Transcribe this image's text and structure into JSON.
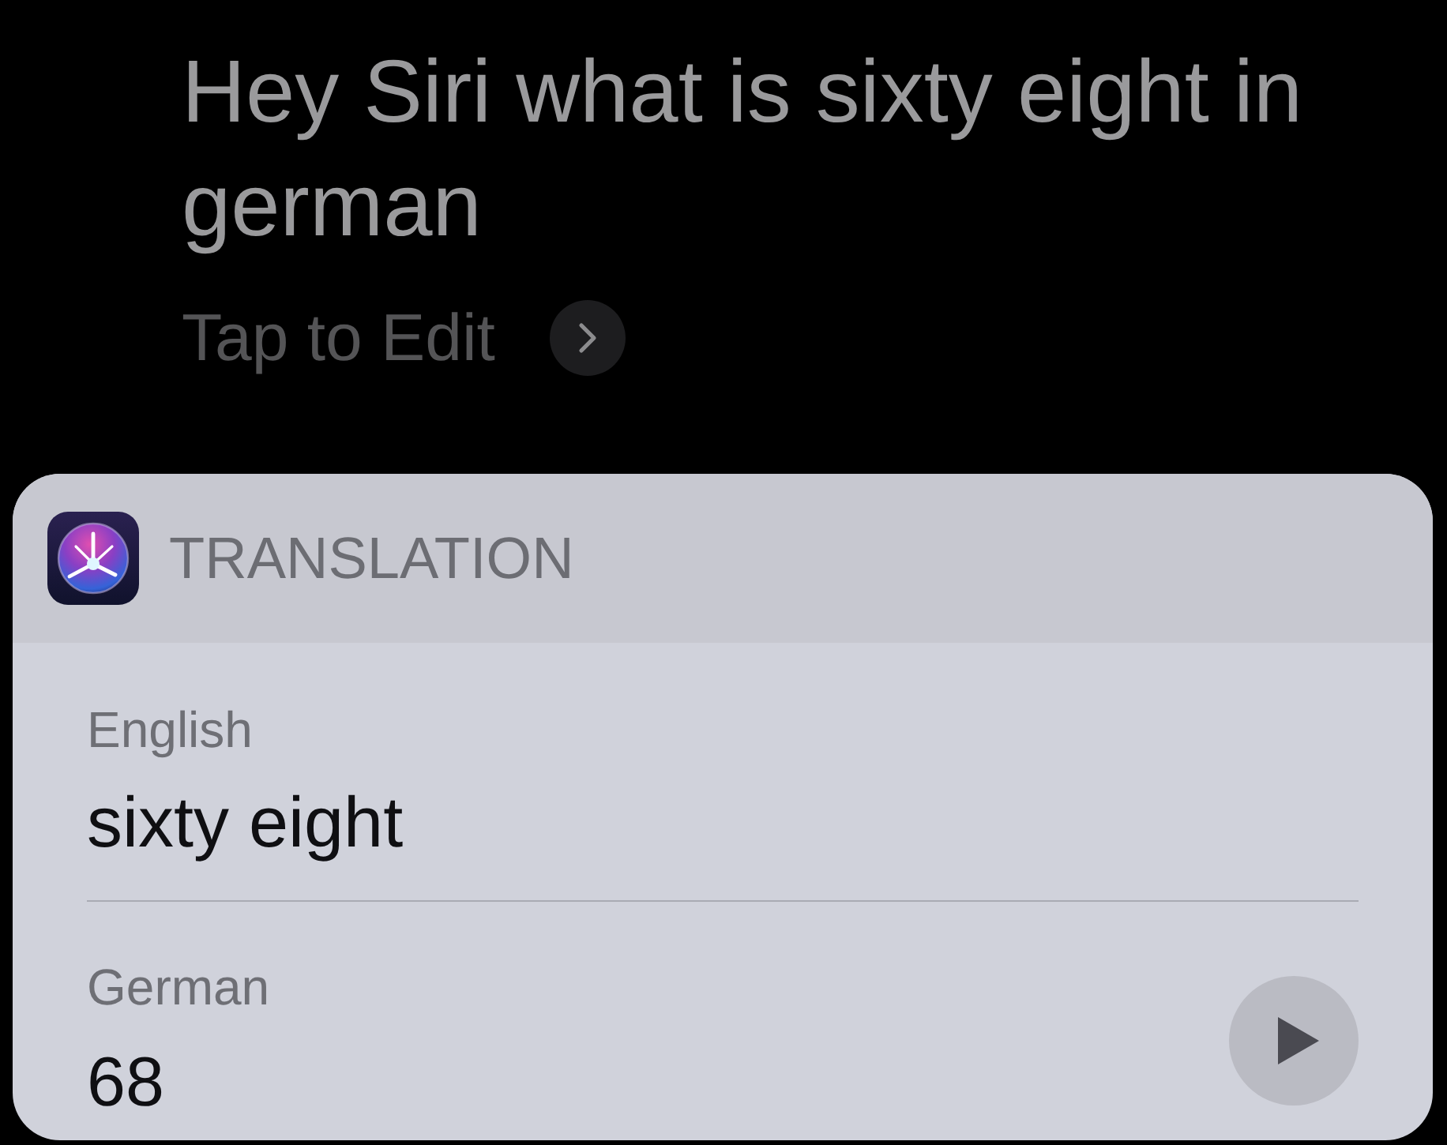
{
  "query": {
    "text": "Hey Siri what is sixty eight in german",
    "edit_label": "Tap to Edit"
  },
  "card": {
    "title": "TRANSLATION",
    "entries": [
      {
        "kind": "source",
        "language": "English",
        "text": "sixty eight"
      },
      {
        "kind": "target",
        "language": "German",
        "text": "68"
      }
    ]
  }
}
